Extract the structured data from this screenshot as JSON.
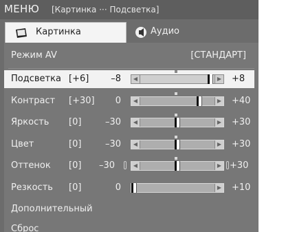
{
  "header": {
    "menu_title": "МЕНЮ",
    "breadcrumb": "[Картинка ··· Подсветка]"
  },
  "tabs": [
    {
      "label": "Картинка",
      "icon": "picture-icon",
      "active": true
    },
    {
      "label": "Аудио",
      "icon": "audio-icon",
      "active": false
    }
  ],
  "mode": {
    "label": "Режим AV",
    "value": "[СТАНДАРТ]"
  },
  "settings": [
    {
      "label": "Подсветка",
      "adjust": "[+6]",
      "min": "–8",
      "max": "+8",
      "level": 0.88,
      "selected": true
    },
    {
      "label": "Контраст",
      "adjust": "[+30]",
      "min": "0",
      "max": "+40",
      "level": 0.75
    },
    {
      "label": "Яркость",
      "adjust": "[0]",
      "min": "–30",
      "max": "+30",
      "level": 0.5
    },
    {
      "label": "Цвет",
      "adjust": "[0]",
      "min": "–30",
      "max": "+30",
      "level": 0.5
    },
    {
      "label": "Оттенок",
      "adjust": "[0]",
      "min": "–30",
      "max": "+30",
      "level": 0.5,
      "endcaps": true
    },
    {
      "label": "Резкость",
      "adjust": "[0]",
      "min": "0",
      "max": "+10",
      "level": 0.0
    }
  ],
  "extra": [
    {
      "label": "Дополнительный"
    },
    {
      "label": "Сброс"
    }
  ],
  "colors": {
    "panel": "#6c6c6c",
    "selected_row": "#f2f2f2",
    "text": "#f0f0f0"
  }
}
